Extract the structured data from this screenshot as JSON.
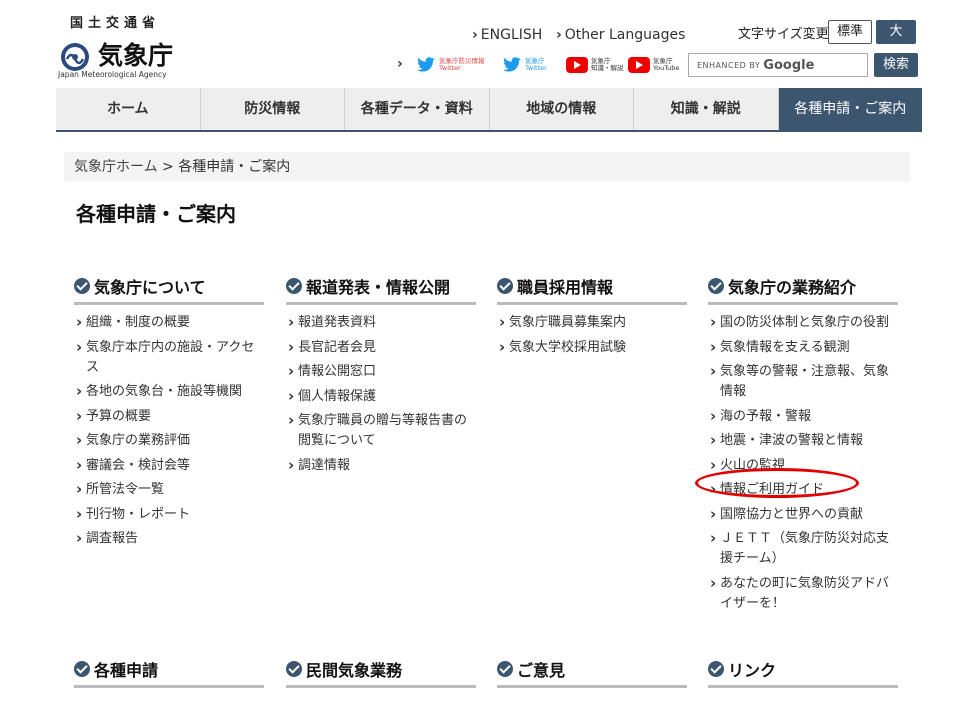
{
  "header": {
    "ministry": "国土交通省",
    "agency_name": "気象庁",
    "agency_en": "Japan Meteorological Agency",
    "lang_english": "ENGLISH",
    "lang_other": "Other Languages",
    "fontsize_label": "文字サイズ変更",
    "fontsize_standard": "標準",
    "fontsize_large": "大",
    "sns": [
      {
        "line1": "気象庁防災情報",
        "line2": "Twitter"
      },
      {
        "line1": "気象庁",
        "line2": "Twitter"
      },
      {
        "line1": "気象庁",
        "line2": "知識・解説"
      },
      {
        "line1": "気象庁",
        "line2": "YouTube"
      }
    ],
    "search_enhanced": "ENHANCED BY",
    "search_google": "Google",
    "search_button": "検索"
  },
  "nav": {
    "items": [
      "ホーム",
      "防災情報",
      "各種データ・資料",
      "地域の情報",
      "知識・解説",
      "各種申請・ご案内"
    ]
  },
  "breadcrumb": {
    "home": "気象庁ホーム",
    "separator": ">",
    "current": "各種申請・ご案内"
  },
  "page_title": "各種申請・ご案内",
  "sections": [
    {
      "title": "気象庁について",
      "items": [
        "組織・制度の概要",
        "気象庁本庁内の施設・アクセス",
        "各地の気象台・施設等機関",
        "予算の概要",
        "気象庁の業務評価",
        "審議会・検討会等",
        "所管法令一覧",
        "刊行物・レポート",
        "調査報告"
      ]
    },
    {
      "title": "報道発表・情報公開",
      "items": [
        "報道発表資料",
        "長官記者会見",
        "情報公開窓口",
        "個人情報保護",
        "気象庁職員の贈与等報告書の閲覧について",
        "調達情報"
      ]
    },
    {
      "title": "職員採用情報",
      "items": [
        "気象庁職員募集案内",
        "気象大学校採用試験"
      ]
    },
    {
      "title": "気象庁の業務紹介",
      "items": [
        "国の防災体制と気象庁の役割",
        "気象情報を支える観測",
        "気象等の警報・注意報、気象情報",
        "海の予報・警報",
        "地震・津波の警報と情報",
        "火山の監視",
        "情報ご利用ガイド",
        "国際協力と世界への貢献",
        "ＪＥＴＴ（気象庁防災対応支援チーム）",
        "あなたの町に気象防災アドバイザーを！"
      ]
    },
    {
      "title": "各種申請",
      "items": []
    },
    {
      "title": "民間気象業務",
      "items": []
    },
    {
      "title": "ご意見",
      "items": []
    },
    {
      "title": "リンク",
      "items": []
    }
  ],
  "colors": {
    "accent": "#3d5670",
    "highlight_ring": "#e00000"
  }
}
